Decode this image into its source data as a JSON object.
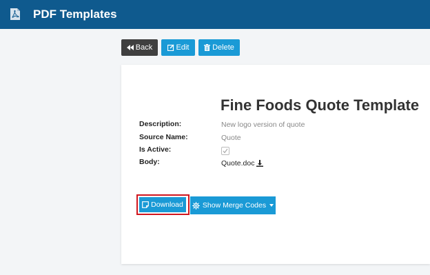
{
  "app": {
    "title": "PDF Templates",
    "icon": "pdf-document-icon"
  },
  "toolbar": {
    "back_label": "Back",
    "edit_label": "Edit",
    "delete_label": "Delete"
  },
  "template": {
    "title": "Fine Foods Quote Template",
    "fields": {
      "description_label": "Description:",
      "description_value": "New logo version of quote",
      "source_name_label": "Source Name:",
      "source_name_value": "Quote",
      "is_active_label": "Is Active:",
      "is_active_value": true,
      "body_label": "Body:",
      "body_value": "Quote.doc"
    }
  },
  "actions": {
    "download_label": "Download",
    "merge_codes_label": "Show Merge Codes"
  },
  "colors": {
    "header": "#0f5a8e",
    "primary": "#1a9ad6",
    "back": "#3f3f3f",
    "highlight": "#d0161e"
  }
}
